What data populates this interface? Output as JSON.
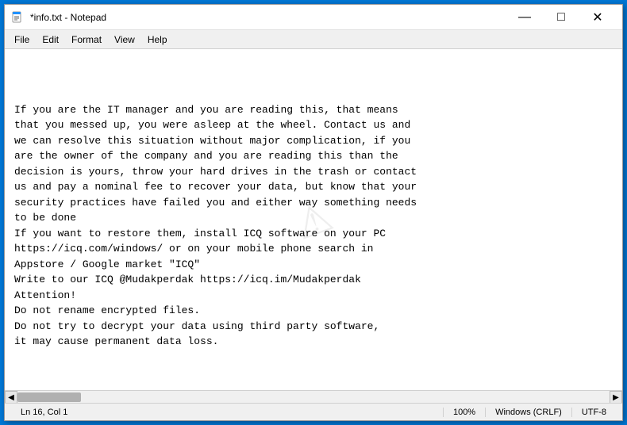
{
  "window": {
    "title": "*info.txt - Notepad",
    "icon": "📄"
  },
  "titlebar": {
    "minimize_label": "—",
    "maximize_label": "□",
    "close_label": "✕"
  },
  "menubar": {
    "items": [
      {
        "label": "File"
      },
      {
        "label": "Edit"
      },
      {
        "label": "Format"
      },
      {
        "label": "View"
      },
      {
        "label": "Help"
      }
    ]
  },
  "editor": {
    "content": "If you are the IT manager and you are reading this, that means\nthat you messed up, you were asleep at the wheel. Contact us and\nwe can resolve this situation without major complication, if you\nare the owner of the company and you are reading this than the\ndecision is yours, throw your hard drives in the trash or contact\nus and pay a nominal fee to recover your data, but know that your\nsecurity practices have failed you and either way something needs\nto be done\nIf you want to restore them, install ICQ software on your PC\nhttps://icq.com/windows/ or on your mobile phone search in\nAppstore / Google market \"ICQ\"\nWrite to our ICQ @Mudakperdak https://icq.im/Mudakperdak\nAttention!\nDo not rename encrypted files.\nDo not try to decrypt your data using third party software,\nit may cause permanent data loss."
  },
  "statusbar": {
    "position": "Ln 16, Col 1",
    "zoom": "100%",
    "line_ending": "Windows (CRLF)",
    "encoding": "UTF-8"
  }
}
